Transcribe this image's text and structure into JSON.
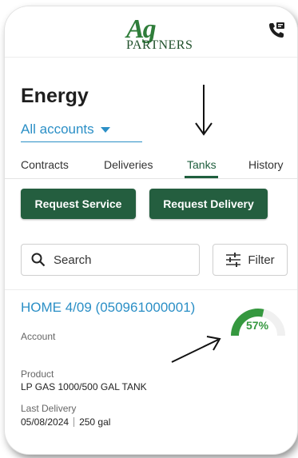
{
  "header": {
    "logo_ag": "Ag",
    "logo_partners": "PARTNERS",
    "phone_icon": "phone-support-icon"
  },
  "page": {
    "title": "Energy",
    "account_selector": "All accounts"
  },
  "tabs": [
    {
      "label": "Contracts"
    },
    {
      "label": "Deliveries"
    },
    {
      "label": "Tanks",
      "active": true
    },
    {
      "label": "History"
    }
  ],
  "actions": {
    "request_service": "Request Service",
    "request_delivery": "Request Delivery"
  },
  "search": {
    "label": "Search",
    "filter_label": "Filter"
  },
  "tank_card": {
    "title": "HOME 4/09 (050961000001)",
    "account_label": "Account",
    "product_label": "Product",
    "product_value": "LP GAS 1000/500 GAL TANK",
    "last_delivery_label": "Last Delivery",
    "last_delivery_date": "05/08/2024",
    "last_delivery_amount": "250 gal",
    "fill_percent": 57,
    "fill_label": "57%"
  },
  "colors": {
    "brand_green": "#245e3f",
    "link_blue": "#2b8fc6",
    "gauge_green": "#35983f"
  }
}
